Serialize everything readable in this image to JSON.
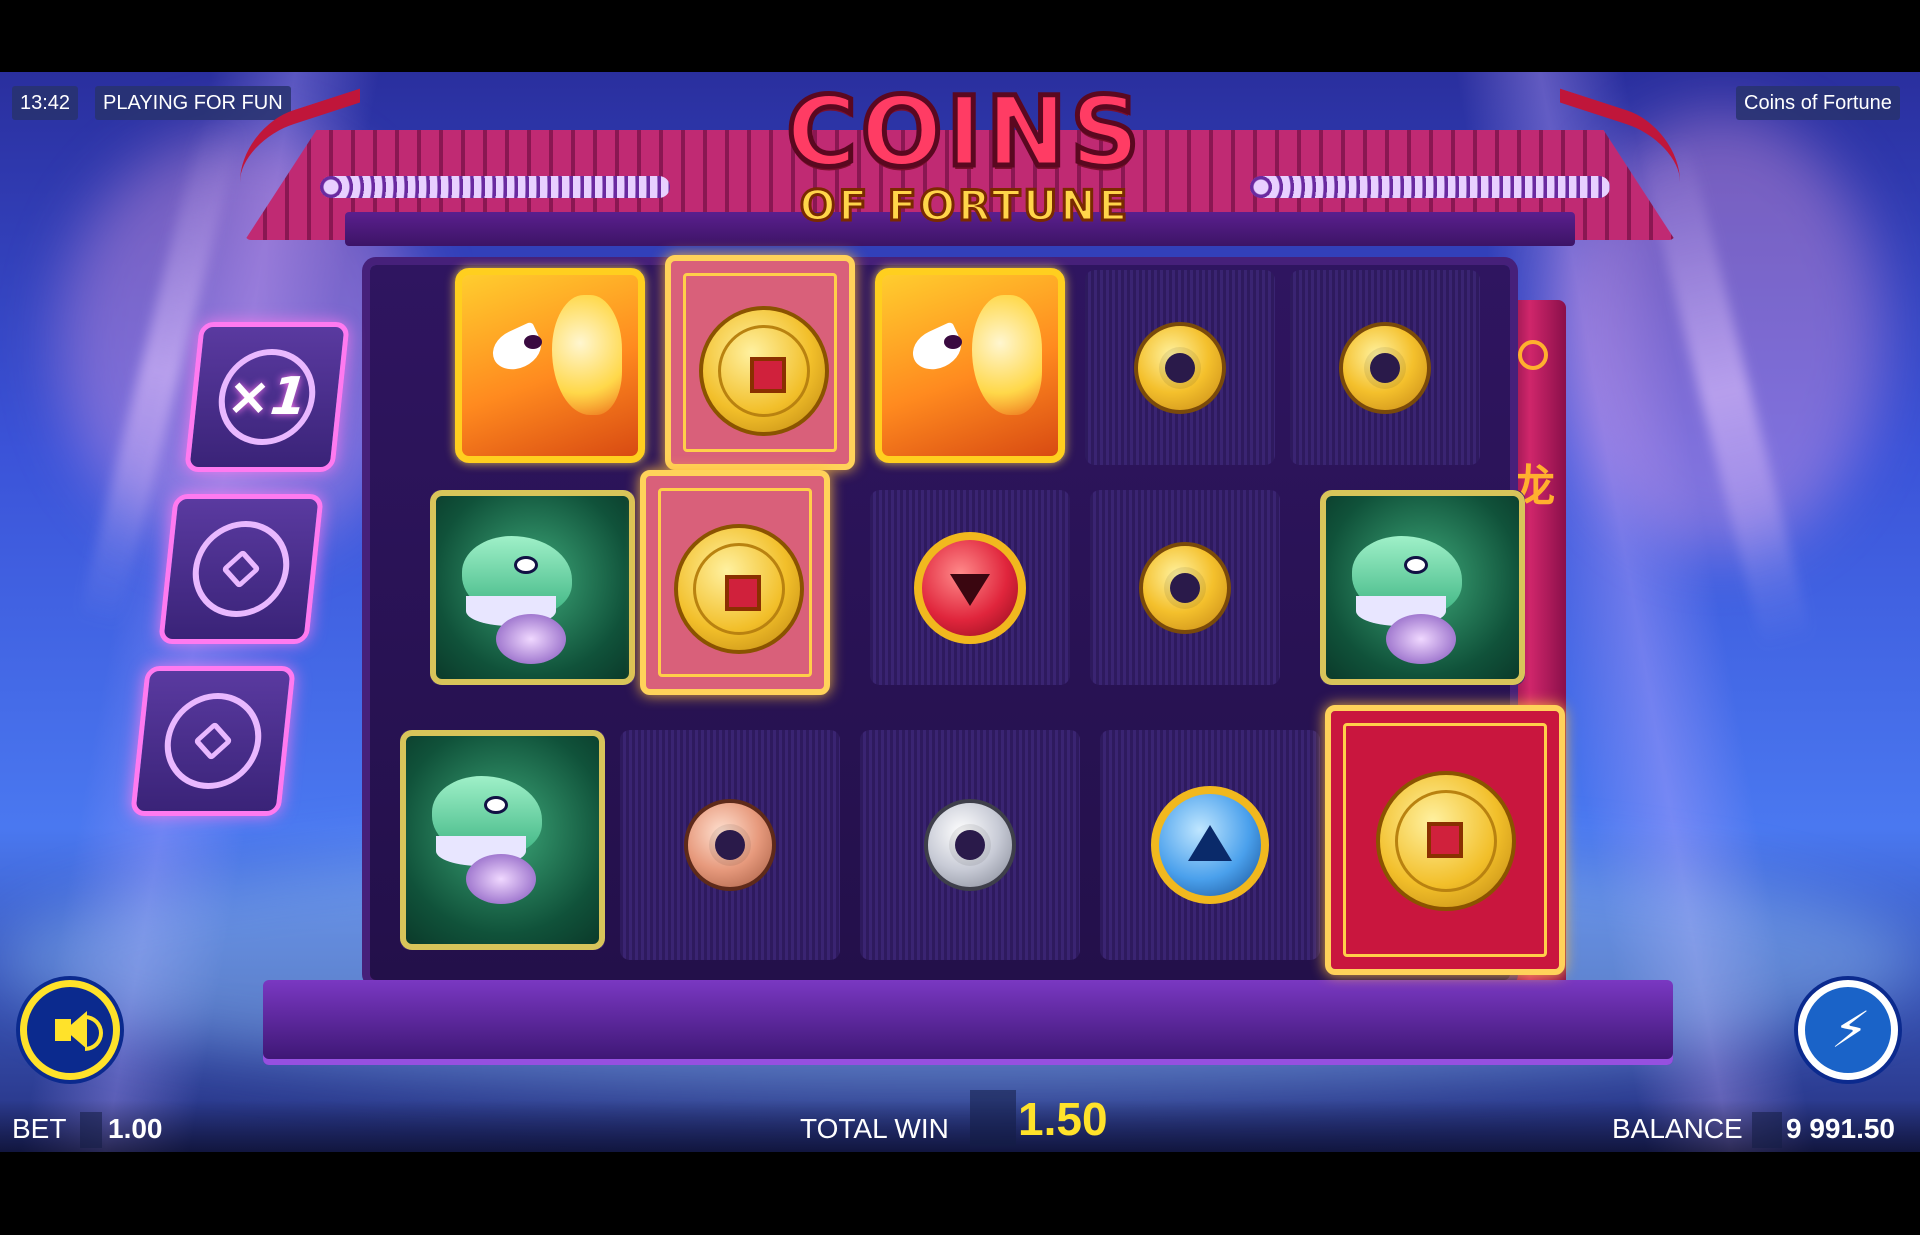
{
  "hud": {
    "time": "13:42",
    "mode": "PLAYING FOR FUN",
    "game_title": "Coins of Fortune"
  },
  "logo": {
    "line1": "COINS",
    "line2": "OF FORTUNE"
  },
  "multipliers": [
    {
      "label": "×1",
      "active": true
    },
    {
      "label": "",
      "active": false
    },
    {
      "label": "",
      "active": false
    }
  ],
  "reels": {
    "rows": 3,
    "columns": 5,
    "grid": [
      [
        "phoenix",
        "coin-card-soft",
        "phoenix",
        "gold-coin",
        "gold-coin"
      ],
      [
        "dragon",
        "coin-card-soft",
        "red-coin",
        "gold-coin",
        "dragon"
      ],
      [
        "dragon",
        "bronze-coin",
        "silver-coin",
        "blue-coin",
        "coin-card"
      ]
    ]
  },
  "footer": {
    "bet_label": "BET",
    "bet_value": "1.00",
    "total_win_label": "TOTAL WIN",
    "total_win_value": "1.50",
    "balance_label": "BALANCE",
    "balance_value": "9 991.50"
  },
  "controls": {
    "sound_icon": "speaker-icon",
    "turbo_icon": "lightning-icon"
  },
  "colors": {
    "accent_yellow": "#ffe22a",
    "temple_red": "#c0163a",
    "multiplier_glow": "#ff7af0"
  }
}
